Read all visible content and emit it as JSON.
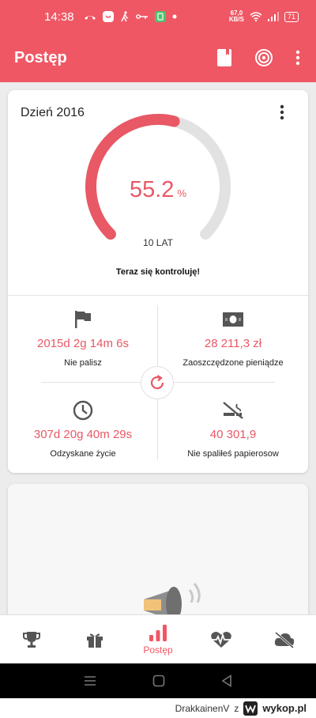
{
  "statusbar": {
    "time": "14:38",
    "net_speed": "67,0",
    "net_unit": "KB/S",
    "battery": "71"
  },
  "appbar": {
    "title": "Postęp",
    "actions": [
      "journal-icon",
      "target-icon",
      "more-vert-icon"
    ]
  },
  "progress_card": {
    "day_label": "Dzień 2016",
    "percent_value": "55.2",
    "percent_unit": "%",
    "progress_fraction": 0.552,
    "goal_label": "10 LAT",
    "motto": "Teraz się kontroluję!",
    "accent_color": "#e85865"
  },
  "stats": [
    {
      "icon": "flag-icon",
      "value": "2015d 2g 14m 6s",
      "label": "Nie palisz"
    },
    {
      "icon": "money-icon",
      "value": "28 211,3 zł",
      "label": "Zaoszczędzone pieniądze"
    },
    {
      "icon": "clock-icon",
      "value": "307d 20g 40m 29s",
      "label": "Odzyskane życie"
    },
    {
      "icon": "no-smoking-icon",
      "value": "40 301,9",
      "label": "Nie spaliłeś papierosow"
    }
  ],
  "bottom_nav": {
    "items": [
      {
        "icon": "trophy-icon",
        "label": ""
      },
      {
        "icon": "gift-icon",
        "label": ""
      },
      {
        "icon": "bar-chart-icon",
        "label": "Postęp",
        "active": true
      },
      {
        "icon": "heart-pulse-icon",
        "label": ""
      },
      {
        "icon": "cloud-off-icon",
        "label": ""
      }
    ]
  },
  "watermark": {
    "user": "DrakkainenV",
    "separator": "z",
    "site": "wykop.pl"
  }
}
